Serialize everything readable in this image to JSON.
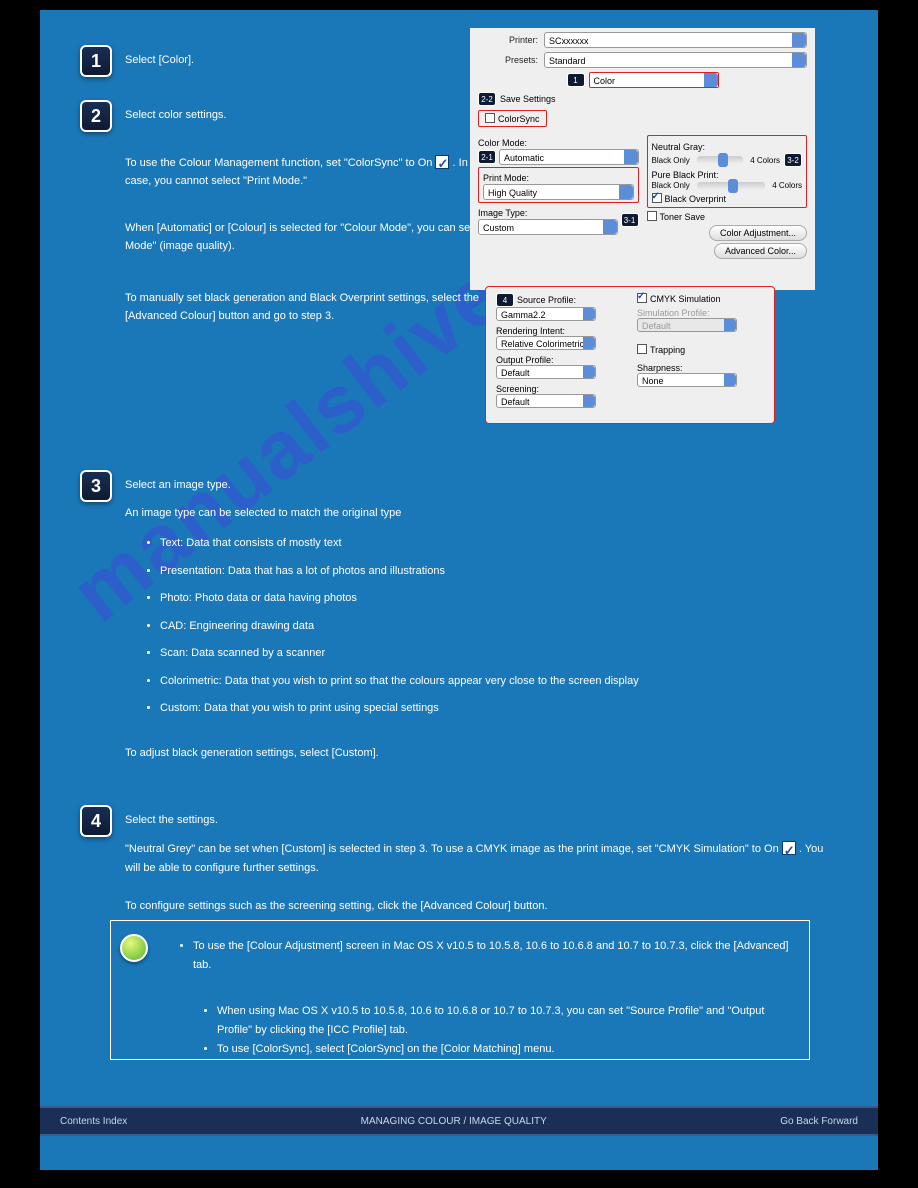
{
  "steps": {
    "s1": {
      "num": "1",
      "text": "Select [Color]."
    },
    "s2": {
      "num": "2",
      "text": "Select color settings.",
      "para1a": "To use the Colour Management function, set \"ColorSync\" to On ",
      "para1b": ". In this case, you cannot select \"Print Mode.\"",
      "para2": "When [Automatic] or [Colour] is selected for \"Colour Mode\", you can set \"Print Mode\" (image quality).",
      "para3": "To manually set black generation and Black Overprint settings, select the [Advanced Colour] button and go to step 3."
    },
    "s3": {
      "num": "3",
      "title": "Select an image type.",
      "intro": "An image type can be selected to match the original type",
      "options": [
        "Text: Data that consists of mostly text",
        "Presentation: Data that has a lot of photos and illustrations",
        "Photo: Photo data or data having photos",
        "CAD: Engineering drawing data",
        "Scan: Data scanned by a scanner",
        "Colorimetric: Data that you wish to print so that the colours appear very close to the screen display",
        "Custom: Data that you wish to print using special settings"
      ],
      "outro": "To adjust black generation settings, select [Custom]."
    },
    "s4": {
      "num": "4",
      "title": "Select the settings.",
      "line1a": "\"Neutral Grey\" can be set when [Custom] is selected in step 3. To use a CMYK image as the print image, set \"CMYK Simulation\" to On ",
      "line1b": ". You will be able to configure further settings.",
      "line2": "To configure settings such as the screening setting, click the [Advanced Colour] button."
    }
  },
  "notes": [
    "To use the [Colour Adjustment] screen in Mac OS X v10.5 to 10.5.8, 10.6 to 10.6.8 and 10.7 to 10.7.3, click the [Advanced] tab.",
    "When using Mac OS X v10.5 to 10.5.8, 10.6 to 10.6.8 or 10.7 to 10.7.3, you can set \"Source Profile\" and \"Output Profile\" by clicking the [ICC Profile] tab.",
    "To use [ColorSync], select [ColorSync] on the [Color Matching] menu."
  ],
  "dialog1": {
    "printer_lbl": "Printer:",
    "printer_val": "SCxxxxxx",
    "presets_lbl": "Presets:",
    "presets_val": "Standard",
    "section_val": "Color",
    "save": "Save Settings",
    "colorsync": "ColorSync",
    "colormode_lbl": "Color Mode:",
    "colormode_val": "Automatic",
    "printmode_lbl": "Print Mode:",
    "printmode_val": "High Quality",
    "imagetype_lbl": "Image Type:",
    "imagetype_val": "Custom",
    "neutral": "Neutral Gray:",
    "pureblack": "Pure Black Print:",
    "blackonly": "Black Only",
    "fourcolors": "4 Colors",
    "overprint": "Black Overprint",
    "tonersave": "Toner Save",
    "coloradj": "Color Adjustment...",
    "advcolor": "Advanced Color...",
    "b1": "1",
    "b22": "2-2",
    "b21": "2-1",
    "b31": "3-1",
    "b32": "3-2"
  },
  "dialog2": {
    "b4": "4",
    "src_lbl": "Source Profile:",
    "src_val": "Gamma2.2",
    "rend_lbl": "Rendering Intent:",
    "rend_val": "Relative Colorimetric",
    "out_lbl": "Output Profile:",
    "out_val": "Default",
    "scr_lbl": "Screening:",
    "scr_val": "Default",
    "cmyk": "CMYK Simulation",
    "sim_lbl": "Simulation Profile:",
    "sim_val": "Default",
    "trap": "Trapping",
    "sharp_lbl": "Sharpness:",
    "sharp_val": "None"
  },
  "footer": {
    "left": "Contents   Index",
    "title": "MANAGING COLOUR / IMAGE QUALITY",
    "right": "Go Back   Forward"
  },
  "watermark": "manualshive.com"
}
